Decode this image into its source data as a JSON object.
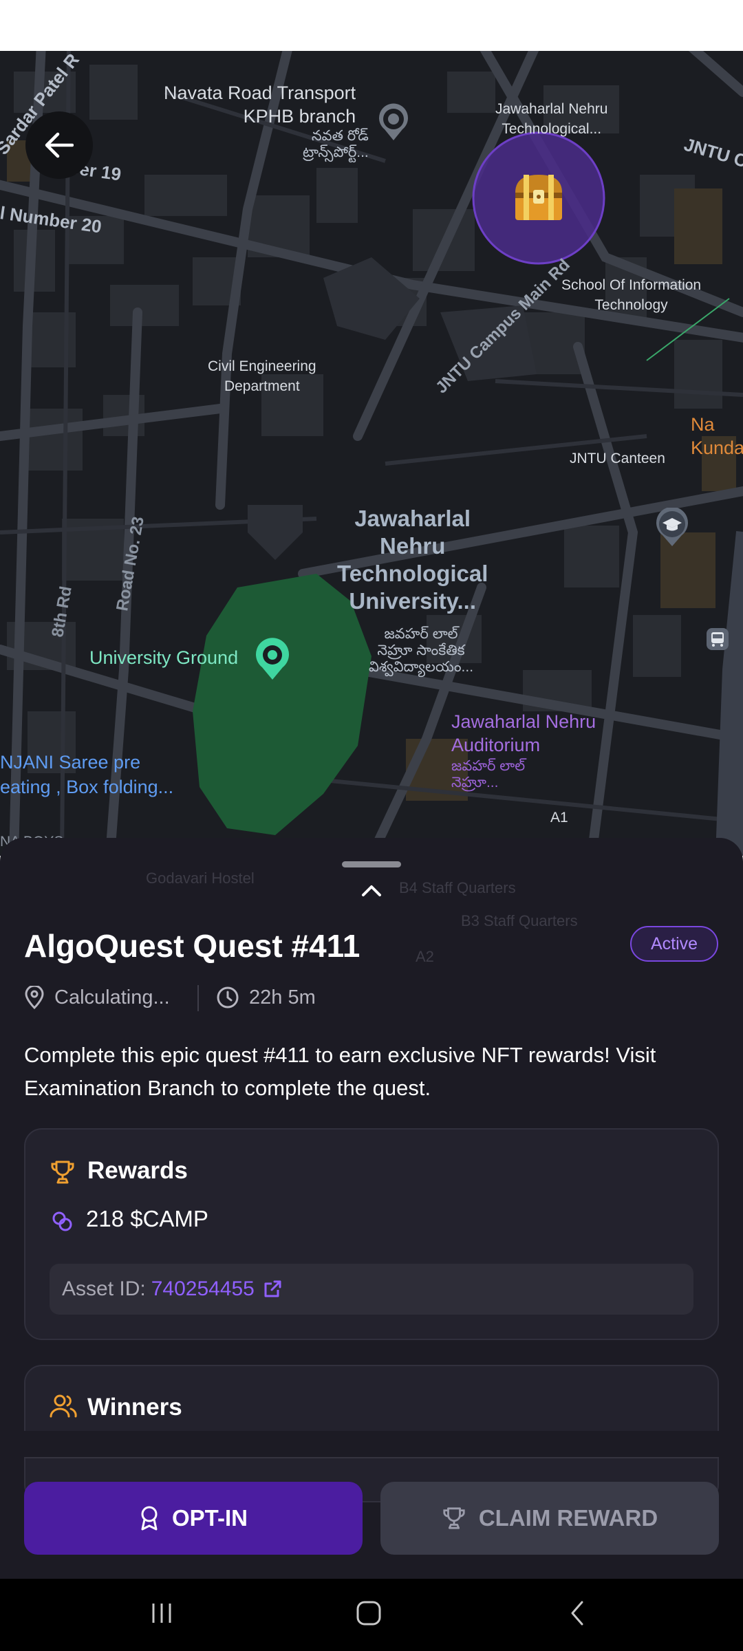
{
  "map": {
    "labels": {
      "navata_transport_en": "Navata Road Transport\nKPHB branch",
      "navata_transport_te": "నవత రోడ్\nట్రాన్స్‌పోర్ట్...",
      "jntu_tech_top": "Jawaharlal Nehru\nTechnological...",
      "jntu_edge": "JNTU C",
      "street_19": "ber 19",
      "street_20": "l Number 20",
      "sardar_patel": "Sardar Patel R",
      "school_it": "School Of Information\nTechnology",
      "civil_eng": "Civil Engineering\nDepartment",
      "jntu_campus_rd": "JNTU Campus Main Rd",
      "jntu_canteen": "JNTU Canteen",
      "na_kunda": "Na\nKunda",
      "road_23": "Road No. 23",
      "rd_8th": "8th Rd",
      "university_big": "Jawaharlal\nNehru\nTechnological\nUniversity...",
      "university_te": "జవహర్ లాల్\nనెహ్రూ సాంకేతిక\nవిశ్వవిద్యాలయం...",
      "university_ground": "University Ground",
      "auditorium_en": "Jawaharlal Nehru\nAuditorium",
      "auditorium_te": "జవహర్ లాల్\nనెహ్రూ...",
      "saree_shop": "NJANI Saree pre\neating , Box folding...",
      "a1": "A1",
      "na_boys": "NA BOYS\nL_JNTU"
    },
    "colors": {
      "background": "#1b1d22",
      "ground": "#1d5a35",
      "quest_marker": "#4a2b8a"
    }
  },
  "sheet": {
    "ghost_labels": {
      "godavari": "Godavari Hostel",
      "b4": "B4 Staff Quarters",
      "b3": "B3 Staff Quarters",
      "a2": "A2"
    },
    "title": "AlgoQuest Quest #411",
    "status": "Active",
    "location_text": "Calculating...",
    "time_left": "22h 5m",
    "description": "Complete this epic quest #411 to earn exclusive NFT rewards! Visit Examination Branch to complete the quest.",
    "rewards": {
      "heading": "Rewards",
      "amount": "218 $CAMP",
      "asset_label": "Asset ID:",
      "asset_id": "740254455"
    },
    "winners": {
      "heading": "Winners"
    },
    "buttons": {
      "opt_in": "OPT-IN",
      "claim": "CLAIM REWARD"
    },
    "colors": {
      "accent": "#4b1da0",
      "link": "#9060ff",
      "trophy": "#f0a030"
    }
  },
  "icons": {
    "back": "back-arrow-icon",
    "location": "map-pin-icon",
    "clock": "clock-icon",
    "trophy": "trophy-icon",
    "coins": "coins-icon",
    "external": "external-link-icon",
    "users": "users-icon",
    "medal": "medal-icon",
    "treasure": "treasure-chest-icon"
  }
}
